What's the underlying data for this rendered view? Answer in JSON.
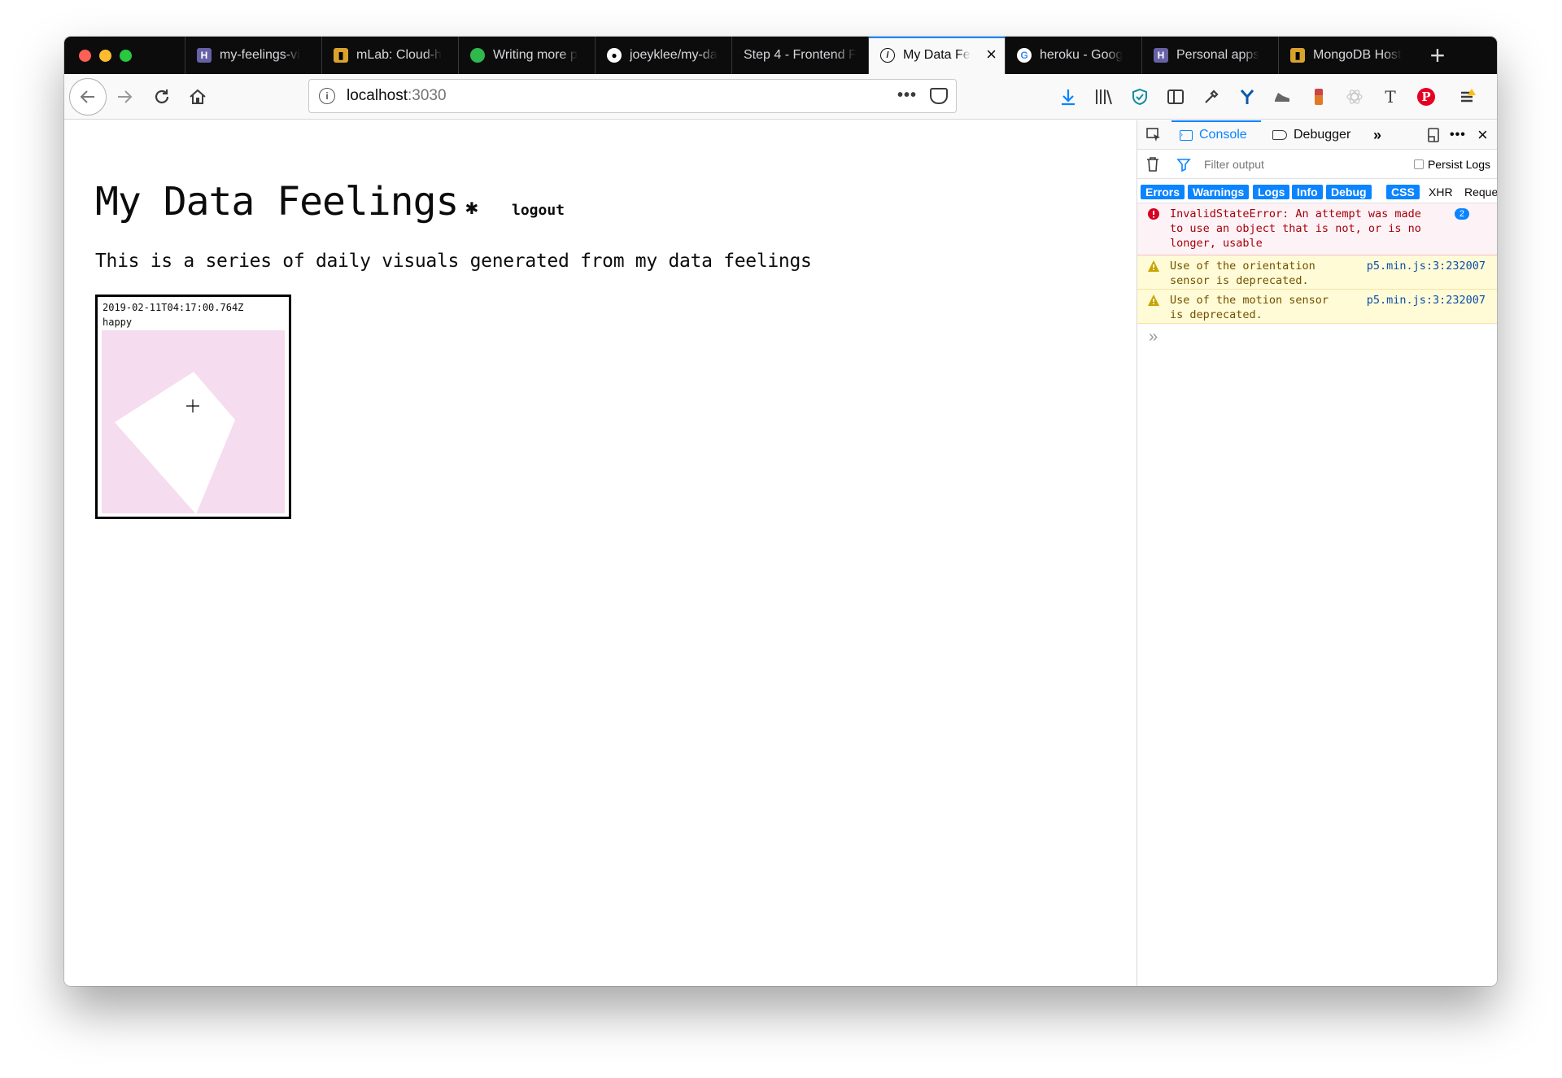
{
  "browser": {
    "tabs": [
      {
        "title": "my-feelings-vi",
        "favicon": "heroku-icon",
        "color": "#6762a6"
      },
      {
        "title": "mLab: Cloud-h",
        "favicon": "mlab-icon",
        "color": "#d9a22c"
      },
      {
        "title": "Writing more p",
        "favicon": "glitch-icon",
        "color": "#2fb94d"
      },
      {
        "title": "joeyklee/my-da",
        "favicon": "github-icon",
        "color": "#ffffff"
      },
      {
        "title": "Step 4 - Frontend F",
        "favicon": "",
        "color": ""
      },
      {
        "title": "My Data Fe",
        "favicon": "p5-icon",
        "color": "#ffffff",
        "active": true
      },
      {
        "title": "heroku - Goog",
        "favicon": "google-icon",
        "color": "#ffffff"
      },
      {
        "title": "Personal apps",
        "favicon": "heroku-icon",
        "color": "#6762a6"
      },
      {
        "title": "MongoDB Host",
        "favicon": "mlab-icon",
        "color": "#d9a22c"
      }
    ],
    "url_host": "localhost",
    "url_port": ":3030"
  },
  "page": {
    "title": "My Data Feelings",
    "logout_label": "logout",
    "intro": "This is a series of daily visuals generated from my data feelings",
    "card": {
      "date": "2019-02-11T04:17:00.764Z",
      "feeling": "happy",
      "background_color": "#f5dcef",
      "shape_color": "#ffffff"
    }
  },
  "devtools": {
    "tabs": {
      "console": "Console",
      "debugger": "Debugger"
    },
    "filter_placeholder": "Filter output",
    "persist_logs": "Persist Logs",
    "levels": [
      "Errors",
      "Warnings",
      "Logs",
      "Info",
      "Debug"
    ],
    "extra_levels": [
      "CSS",
      "XHR",
      "Reque"
    ],
    "messages": [
      {
        "type": "error",
        "text": "InvalidStateError: An attempt was made\nto use an object that is not, or is no\nlonger, usable",
        "count": "2"
      },
      {
        "type": "warning",
        "text": "Use of the orientation\nsensor is deprecated.",
        "source": "p5.min.js:3:232007"
      },
      {
        "type": "warning",
        "text": "Use of the motion sensor\nis deprecated.",
        "source": "p5.min.js:3:232007"
      }
    ]
  }
}
